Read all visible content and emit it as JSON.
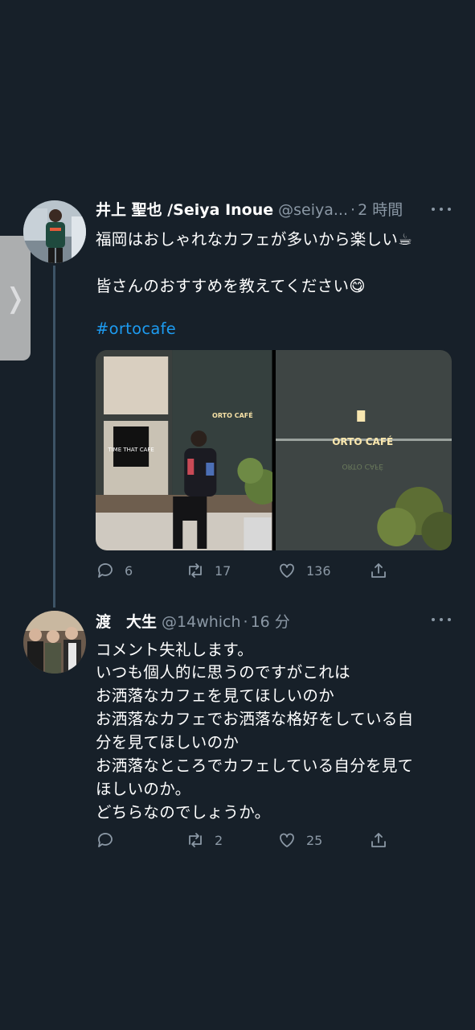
{
  "sidebar_tab": {
    "icon": "chevron-right-icon",
    "glyph": "❭"
  },
  "tweet1": {
    "name": "井上 聖也 /Seiya Inoue",
    "handle": "@seiya...",
    "dot": "·",
    "time": "2 時間",
    "lines": [
      "福岡はおしゃれなカフェが多いから楽しい☕",
      "皆さんのおすすめを教えてください😋"
    ],
    "hashtag": "#ortocafe",
    "media_sign_text": "ORTO CAFÉ",
    "poster_text": "TIME THAT CAFE",
    "stats": {
      "replies": "6",
      "retweets": "17",
      "likes": "136"
    }
  },
  "tweet2": {
    "name": "渡　大生",
    "handle": "@14which",
    "dot": "·",
    "time": "16 分",
    "lines": [
      "コメント失礼します。",
      "いつも個人的に思うのですがこれは",
      "お洒落なカフェを見てほしいのか",
      "お洒落なカフェでお洒落な格好をしている自",
      "分を見てほしいのか",
      "お洒落なところでカフェしている自分を見て",
      "ほしいのか。",
      "どちらなのでしょうか。"
    ],
    "stats": {
      "replies": "",
      "retweets": "2",
      "likes": "25"
    }
  },
  "colors": {
    "background": "#172029",
    "link": "#1d9bf0",
    "secondary_text": "#8b98a5",
    "thread_line": "#3d5466"
  }
}
